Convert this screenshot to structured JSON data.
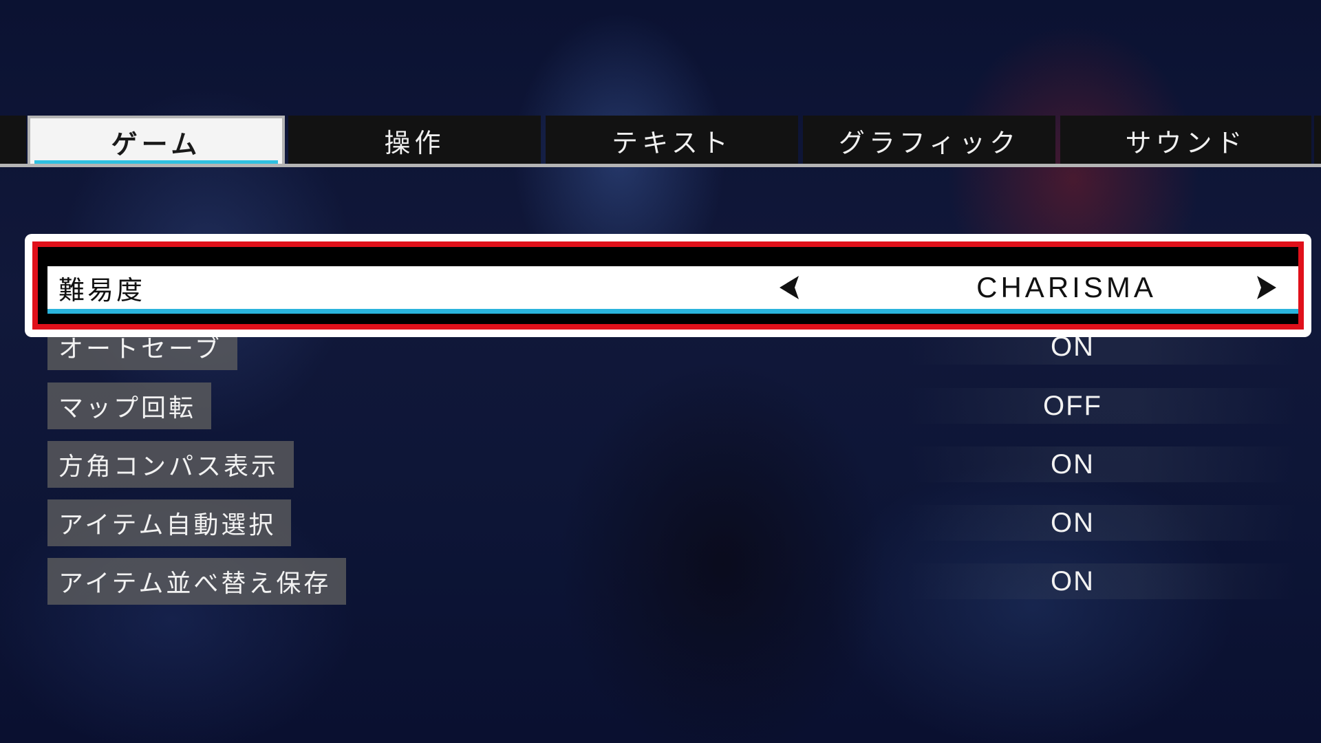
{
  "tabs": [
    {
      "label": "ゲーム",
      "active": true
    },
    {
      "label": "操作",
      "active": false
    },
    {
      "label": "テキスト",
      "active": false
    },
    {
      "label": "グラフィック",
      "active": false
    },
    {
      "label": "サウンド",
      "active": false
    }
  ],
  "options": [
    {
      "label": "難易度",
      "value": "CHARISMA",
      "selected": true
    },
    {
      "label": "オートセーブ",
      "value": "ON"
    },
    {
      "label": "マップ回転",
      "value": "OFF"
    },
    {
      "label": "方角コンパス表示",
      "value": "ON"
    },
    {
      "label": "アイテム自動選択",
      "value": "ON"
    },
    {
      "label": "アイテム並べ替え保存",
      "value": "ON"
    }
  ],
  "icons": {
    "prev": "chevron-left-icon",
    "next": "chevron-right-icon"
  },
  "colors": {
    "accent": "#2ab4dc",
    "highlight_border": "#e0101a"
  }
}
